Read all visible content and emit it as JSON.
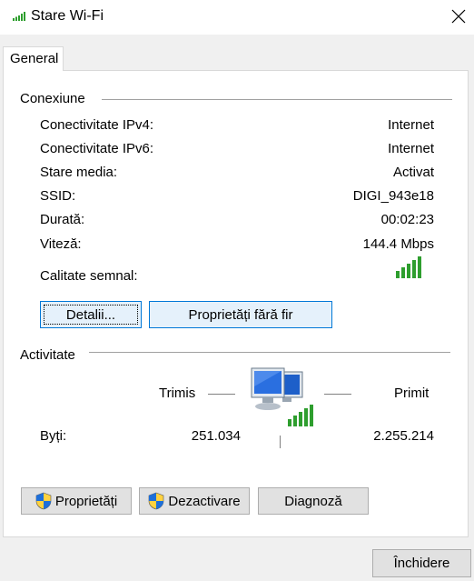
{
  "window": {
    "title": "Stare Wi-Fi"
  },
  "tabs": [
    {
      "label": "General"
    }
  ],
  "connection": {
    "group_title": "Conexiune",
    "rows": [
      {
        "label": "Conectivitate IPv4:",
        "value": "Internet"
      },
      {
        "label": "Conectivitate IPv6:",
        "value": "Internet"
      },
      {
        "label": "Stare media:",
        "value": "Activat"
      },
      {
        "label": "SSID:",
        "value": "DIGI_943e18"
      },
      {
        "label": "Durată:",
        "value": "00:02:23"
      },
      {
        "label": "Viteză:",
        "value": "144.4 Mbps"
      }
    ],
    "signal_label": "Calitate semnal:",
    "signal_bars": 5,
    "signal_bars_total": 5,
    "buttons": {
      "details": "Detalii...",
      "wireless_props": "Proprietăți fără fir"
    }
  },
  "activity": {
    "group_title": "Activitate",
    "sent_label": "Trimis",
    "received_label": "Primit",
    "bytes_label": "Byți:",
    "bytes_sent": "251.034",
    "bytes_received": "2.255.214"
  },
  "actions": {
    "properties": "Proprietăți",
    "disable": "Dezactivare",
    "diagnose": "Diagnoză"
  },
  "footer": {
    "close": "Închidere"
  },
  "colors": {
    "accent": "#0078d7",
    "signal_green": "#2e9e2e",
    "panel_bg": "#ffffff",
    "window_bg": "#f0f0f0"
  }
}
